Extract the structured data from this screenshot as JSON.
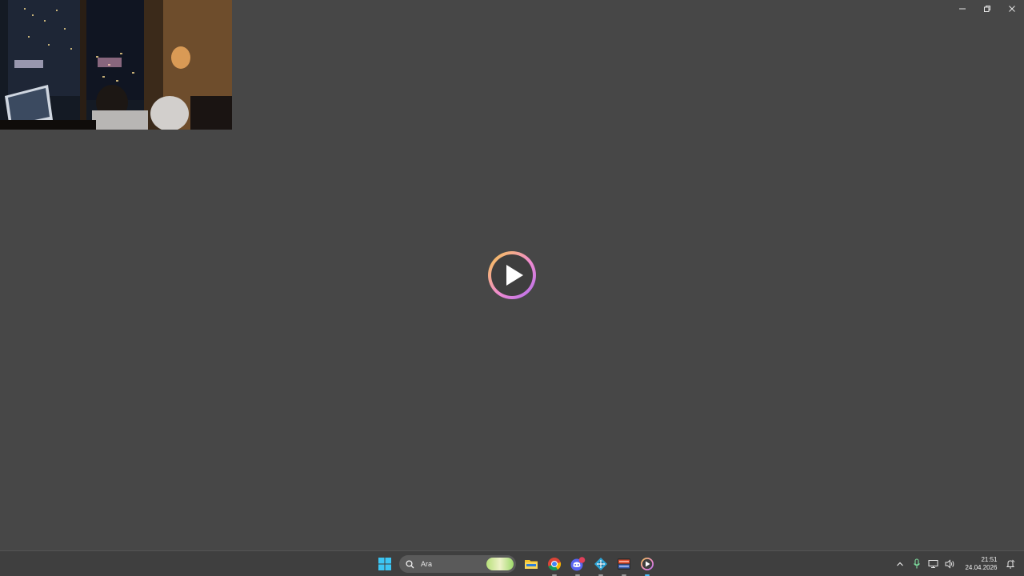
{
  "window": {
    "controls": {
      "minimize": "—",
      "restore": "❐",
      "close": "✕"
    }
  },
  "player": {
    "play_icon": "play-icon",
    "gradient_colors": [
      "#f7c948",
      "#f08bd0",
      "#b06cf0"
    ]
  },
  "taskbar": {
    "search": {
      "placeholder": "Ara"
    },
    "apps": [
      {
        "name": "start-icon"
      },
      {
        "name": "file-explorer-icon"
      },
      {
        "name": "chrome-icon"
      },
      {
        "name": "discord-icon",
        "badge": "9+"
      },
      {
        "name": "app-blue-icon"
      },
      {
        "name": "voicemeeter-icon"
      },
      {
        "name": "media-player-icon"
      }
    ],
    "clock": {
      "time": "21:51",
      "date": "24.04.2026"
    }
  },
  "colors": {
    "desktop": "#474747",
    "taskbar": "#3f3f3f"
  }
}
